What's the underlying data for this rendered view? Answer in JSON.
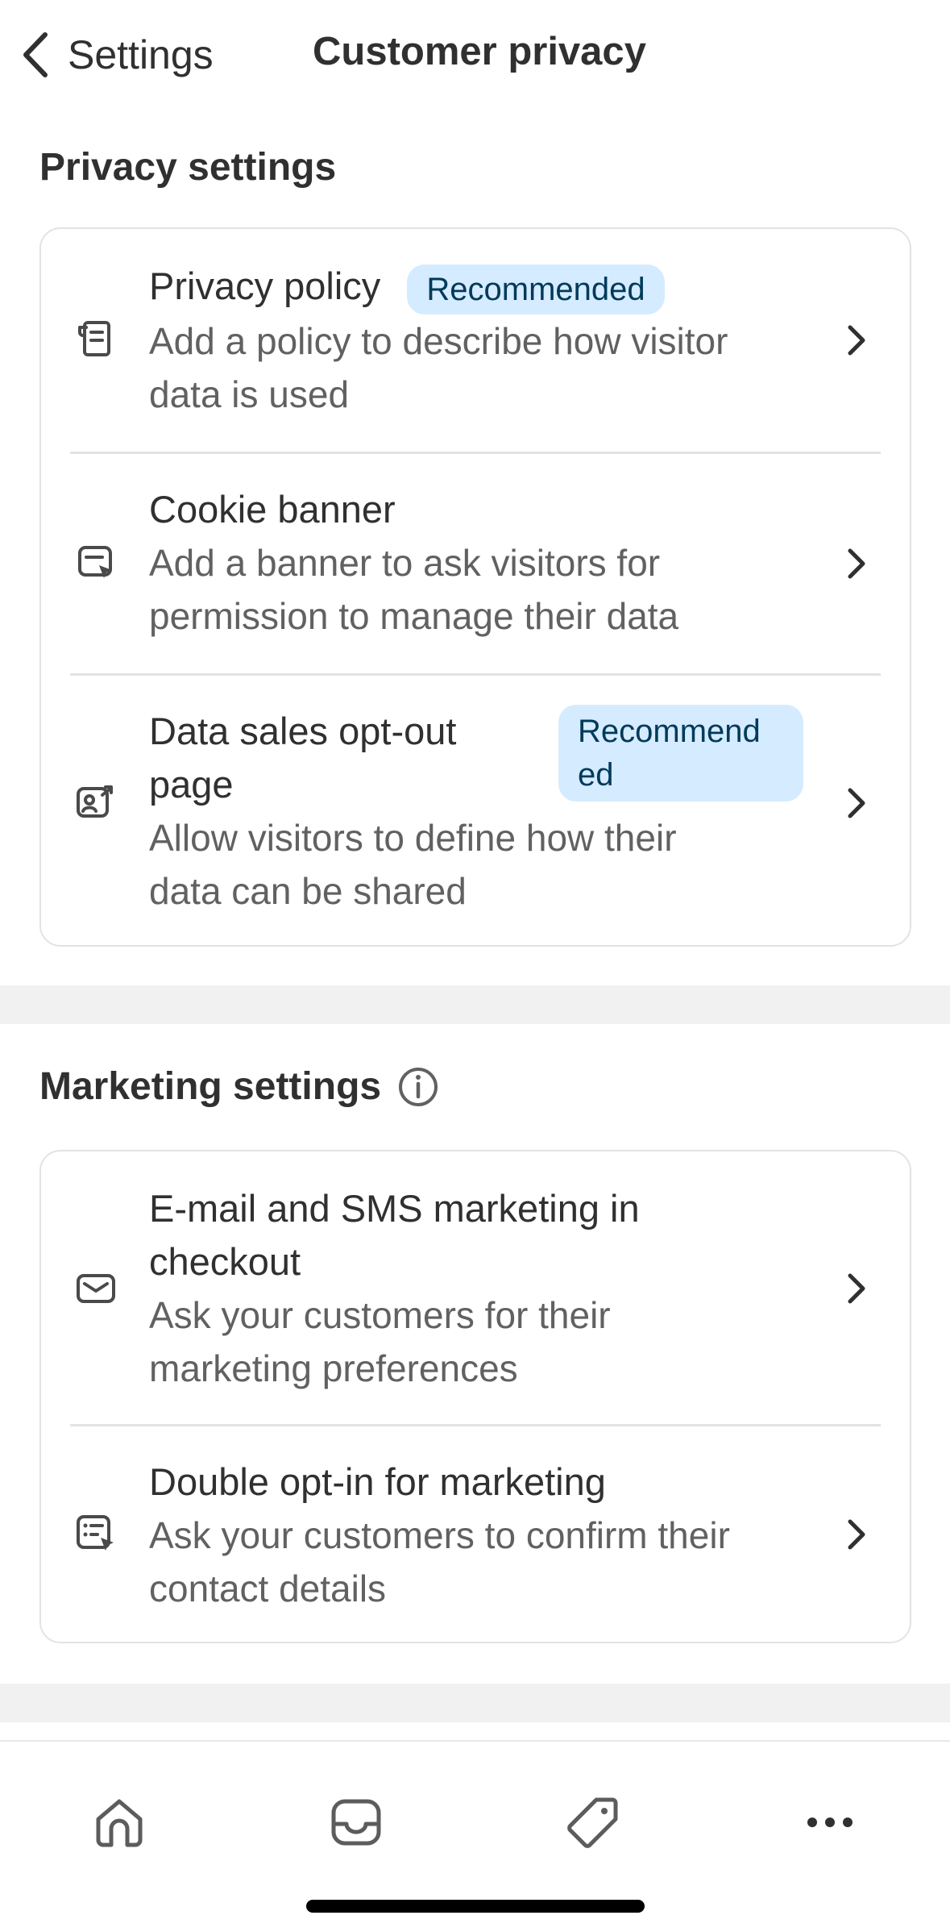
{
  "header": {
    "back_label": "Settings",
    "title": "Customer privacy"
  },
  "privacy": {
    "section_title": "Privacy settings",
    "items": [
      {
        "title": "Privacy policy",
        "badge": "Recommended",
        "desc_line1": "Add a policy to describe how visitor",
        "desc_line2": "data is used",
        "icon": "policy-document-icon"
      },
      {
        "title": "Cookie banner",
        "desc_line1": "Add a banner to ask visitors for",
        "desc_line2": "permission to manage their data",
        "icon": "cookie-banner-icon"
      },
      {
        "title_line1": "Data sales opt-out",
        "title_line2": "page",
        "badge_line1": "Recommend",
        "badge_line2": "ed",
        "desc_line1": "Allow visitors to define how their",
        "desc_line2": "data can be shared",
        "icon": "data-sharing-icon"
      }
    ]
  },
  "marketing": {
    "section_title": "Marketing settings",
    "items": [
      {
        "title_line1": "E-mail and SMS marketing in",
        "title_line2": "checkout",
        "desc_line1": "Ask your customers for their",
        "desc_line2": "marketing preferences",
        "icon": "envelope-icon"
      },
      {
        "title": "Double opt-in for marketing",
        "desc_line1": "Ask your customers to confirm their",
        "desc_line2": "contact details",
        "icon": "form-checklist-icon"
      }
    ]
  },
  "tabbar": {
    "tabs": [
      "home-icon",
      "inbox-icon",
      "tag-icon",
      "more-icon"
    ]
  },
  "colors": {
    "badge_bg": "#d5ebff",
    "badge_text": "#003a5a",
    "text_primary": "#303030",
    "text_secondary": "#616161",
    "border": "#e3e3e3",
    "band": "#f1f1f1"
  }
}
